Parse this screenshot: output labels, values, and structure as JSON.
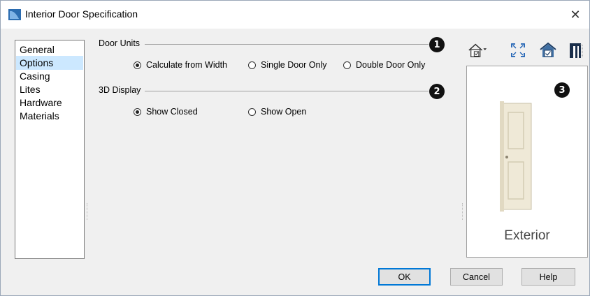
{
  "window": {
    "title": "Interior Door Specification"
  },
  "tabs": [
    {
      "label": "General"
    },
    {
      "label": "Options"
    },
    {
      "label": "Casing"
    },
    {
      "label": "Lites"
    },
    {
      "label": "Hardware"
    },
    {
      "label": "Materials"
    }
  ],
  "selected_tab": "Options",
  "door_units": {
    "label": "Door Units",
    "badge": "1",
    "options": [
      {
        "label": "Calculate from Width",
        "checked": true
      },
      {
        "label": "Single Door Only",
        "checked": false
      },
      {
        "label": "Double Door Only",
        "checked": false
      }
    ]
  },
  "display_3d": {
    "label": "3D Display",
    "badge": "2",
    "options": [
      {
        "label": "Show Closed",
        "checked": true
      },
      {
        "label": "Show Open",
        "checked": false
      }
    ]
  },
  "preview": {
    "badge": "3",
    "caption": "Exterior"
  },
  "toolbar_icons": [
    "house-view-dropdown-icon",
    "fill-window-icon",
    "color-preview-icon",
    "door-frame-icon"
  ],
  "buttons": {
    "ok": "OK",
    "cancel": "Cancel",
    "help": "Help"
  },
  "colors": {
    "selected_tab": "#cce8ff",
    "default_button_border": "#0078d7",
    "badge": "#111111"
  }
}
